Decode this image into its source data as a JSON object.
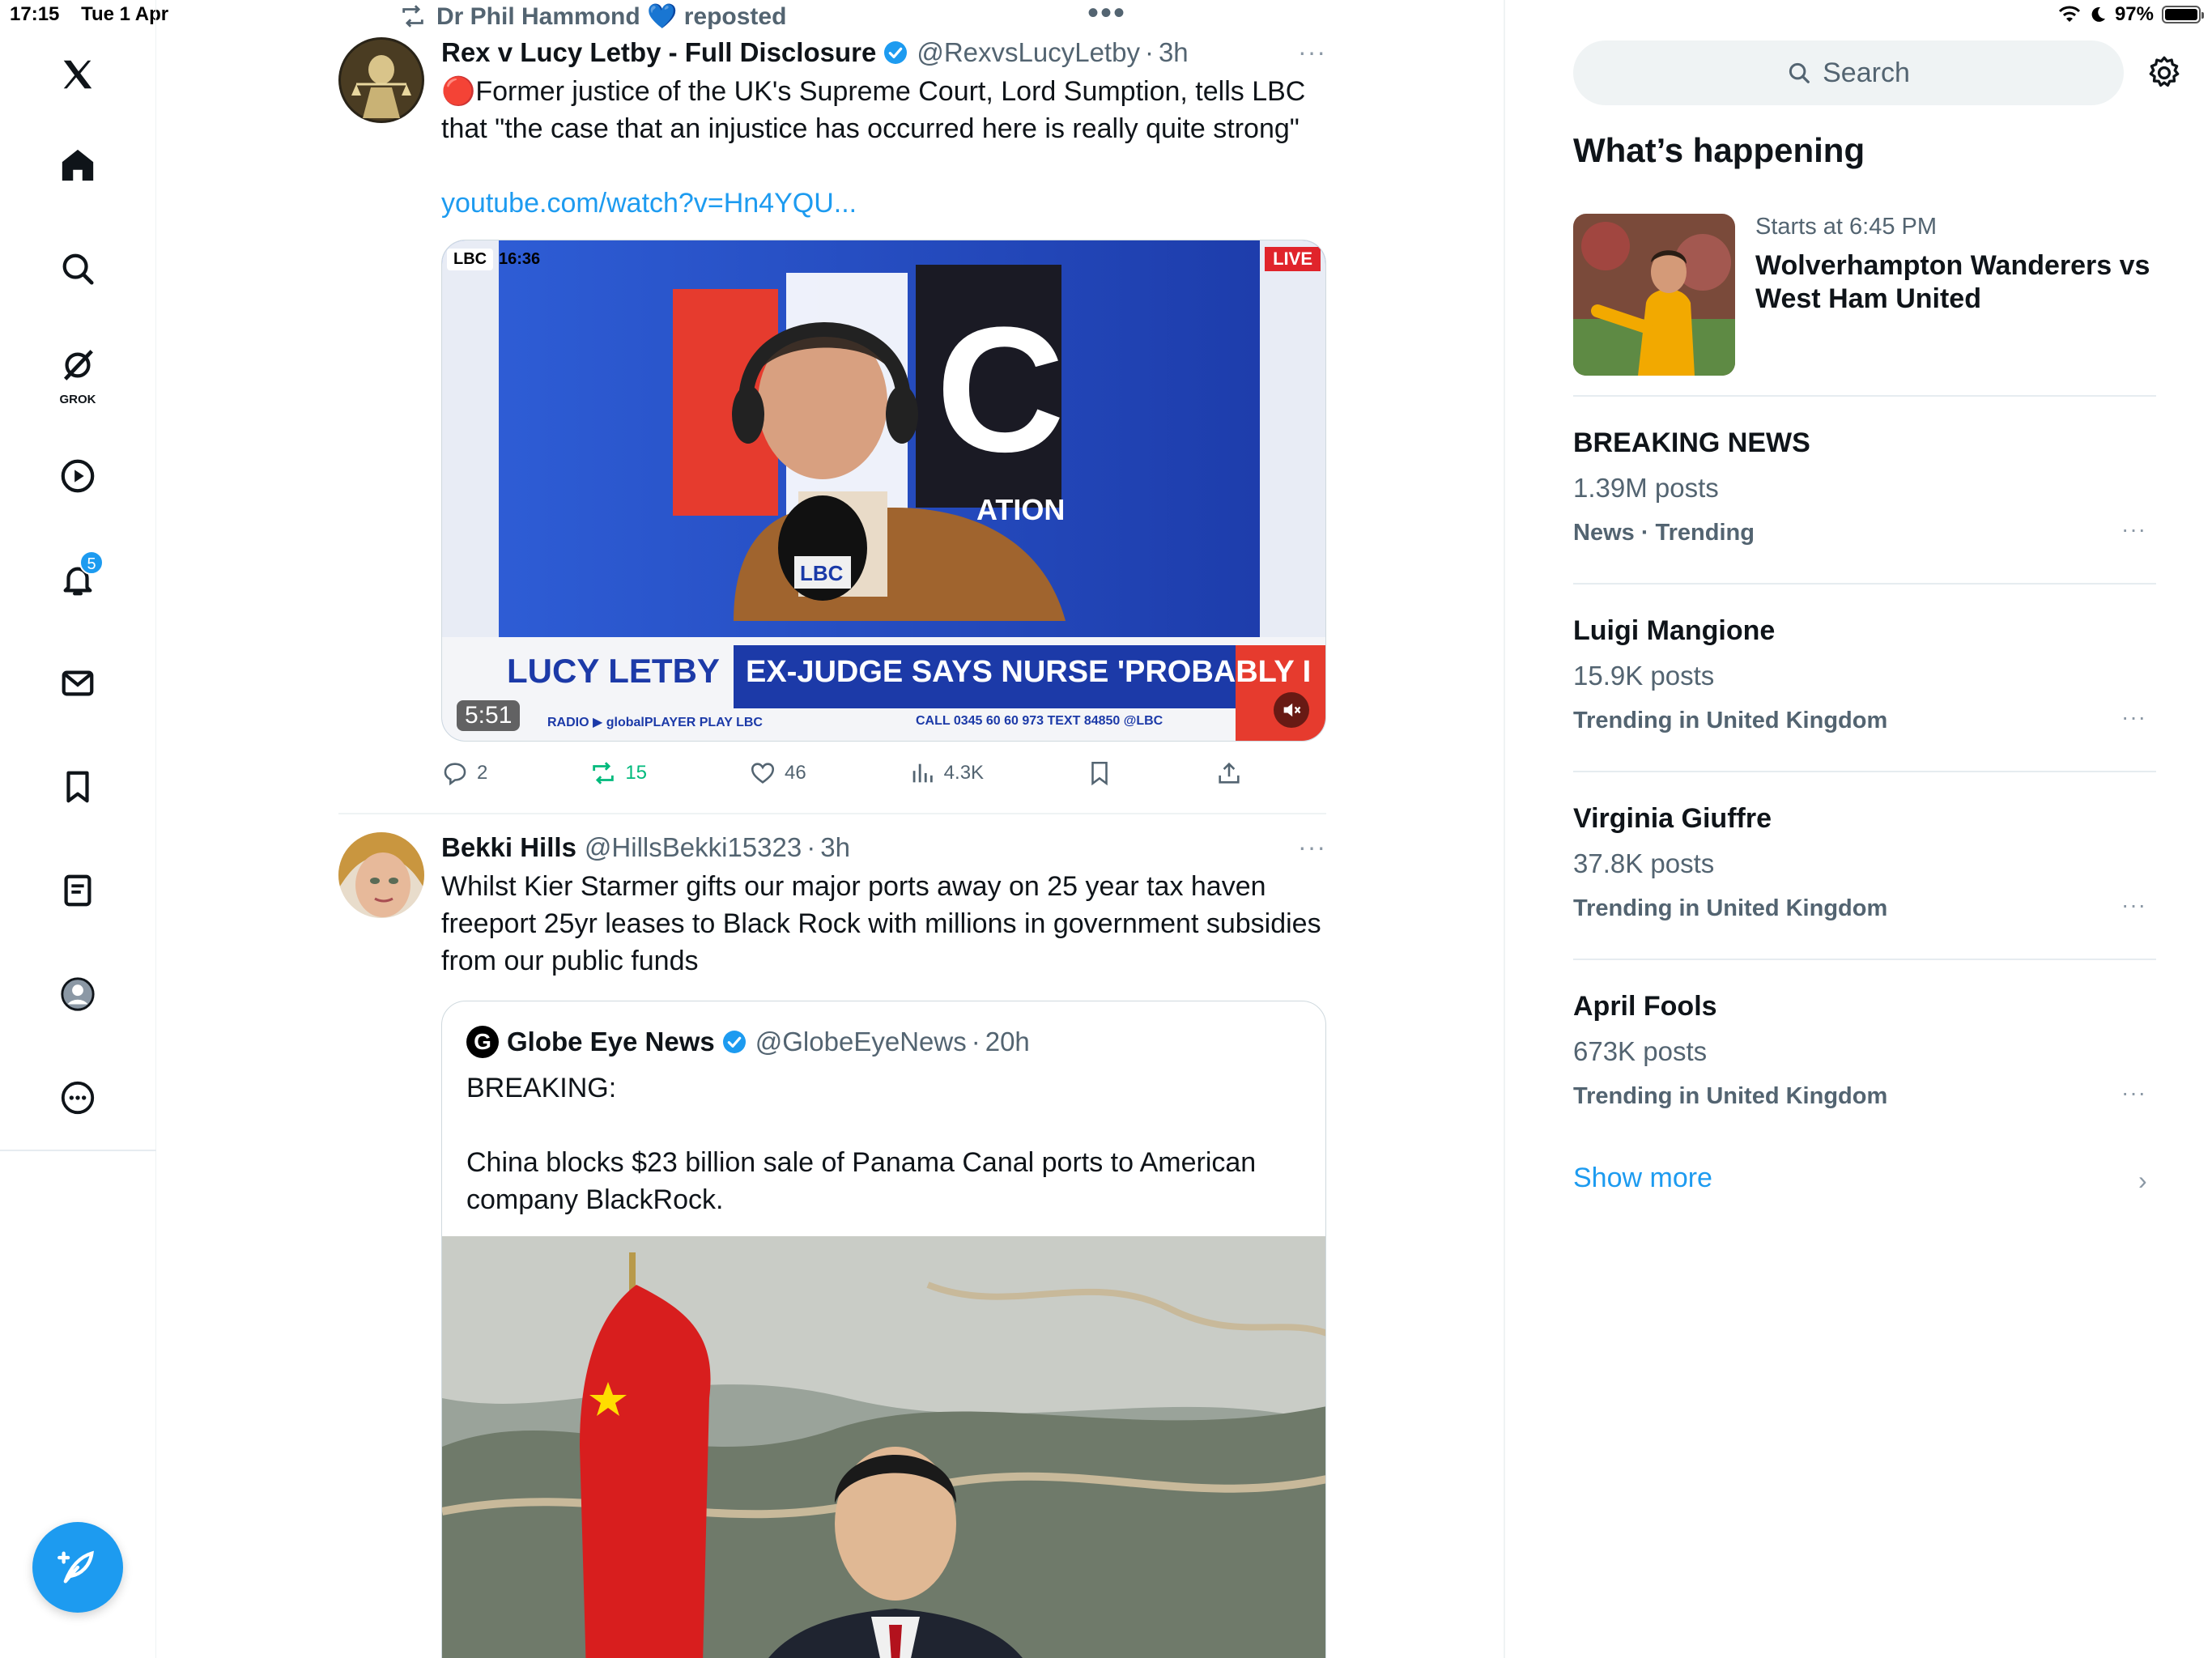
{
  "status_bar": {
    "time": "17:15",
    "date": "Tue 1 Apr",
    "battery": "97%",
    "battery_level": 0.97
  },
  "nav": {
    "items": [
      "x-logo",
      "home",
      "explore",
      "grok",
      "video",
      "notifications",
      "messages",
      "bookmarks",
      "lists",
      "profile",
      "more"
    ],
    "grok_label": "GROK",
    "notification_count": "5",
    "compose_label": "Post"
  },
  "top_dots": "•••",
  "feed": {
    "repost": {
      "text": "Dr Phil Hammond 💙 reposted"
    },
    "tweet1": {
      "name": "Rex v Lucy Letby - Full Disclosure",
      "handle": "@RexvsLucyLetby",
      "sep": "·",
      "time": "3h",
      "more": "···",
      "text": "🔴Former justice of the UK's Supreme Court, Lord Sumption, tells LBC that \"the case that an injustice has occurred here is really quite strong\"",
      "link": "youtube.com/watch?v=Hn4YQU...",
      "video": {
        "duration": "5:51",
        "channel_logo": "LBC",
        "clock": "16:36",
        "live": "LIVE",
        "lower_third_name": "LUCY LETBY",
        "lower_third_headline": "EX-JUDGE SAYS NURSE 'PROBABLY INNOCENT'",
        "ticker": "CALL 0345 60 60 973   TEXT 84850   @LBC",
        "ticker_left": "RADIO  ▶ globalPLAYER   PLAY LBC"
      },
      "stats": {
        "replies": "2",
        "reposts": "15",
        "likes": "46",
        "views": "4.3K"
      }
    },
    "tweet2": {
      "name": "Bekki Hills",
      "handle": "@HillsBekki15323",
      "sep": "·",
      "time": "3h",
      "more": "···",
      "text": "Whilst Kier Starmer gifts our major ports away on 25 year tax haven freeport 25yr leases to Black Rock with millions in government subsidies from our public funds",
      "quote": {
        "logo": "G",
        "name": "Globe Eye News",
        "handle": "@GlobeEyeNews",
        "sep": "·",
        "time": "20h",
        "text": "BREAKING:\n\nChina blocks $23 billion sale of Panama Canal ports to American company BlackRock."
      }
    }
  },
  "sidebar": {
    "search_placeholder": "Search",
    "section_title": "What’s happening",
    "event": {
      "subtitle": "Starts at 6:45 PM",
      "title": "Wolverhampton Wanderers vs West Ham United"
    },
    "trends": [
      {
        "title": "BREAKING NEWS",
        "count": "1.39M posts",
        "category": "News · Trending",
        "more": "···"
      },
      {
        "title": "Luigi Mangione",
        "count": "15.9K posts",
        "category": "Trending in United Kingdom",
        "more": "···"
      },
      {
        "title": "Virginia Giuffre",
        "count": "37.8K posts",
        "category": "Trending in United Kingdom",
        "more": "···"
      },
      {
        "title": "April Fools",
        "count": "673K posts",
        "category": "Trending in United Kingdom",
        "more": "···"
      }
    ],
    "show_more": "Show more",
    "chevron": "›"
  },
  "colors": {
    "accent": "#1d9bf0",
    "repost_green": "#00ba7c",
    "text": "#0f1419",
    "muted": "#536471"
  }
}
